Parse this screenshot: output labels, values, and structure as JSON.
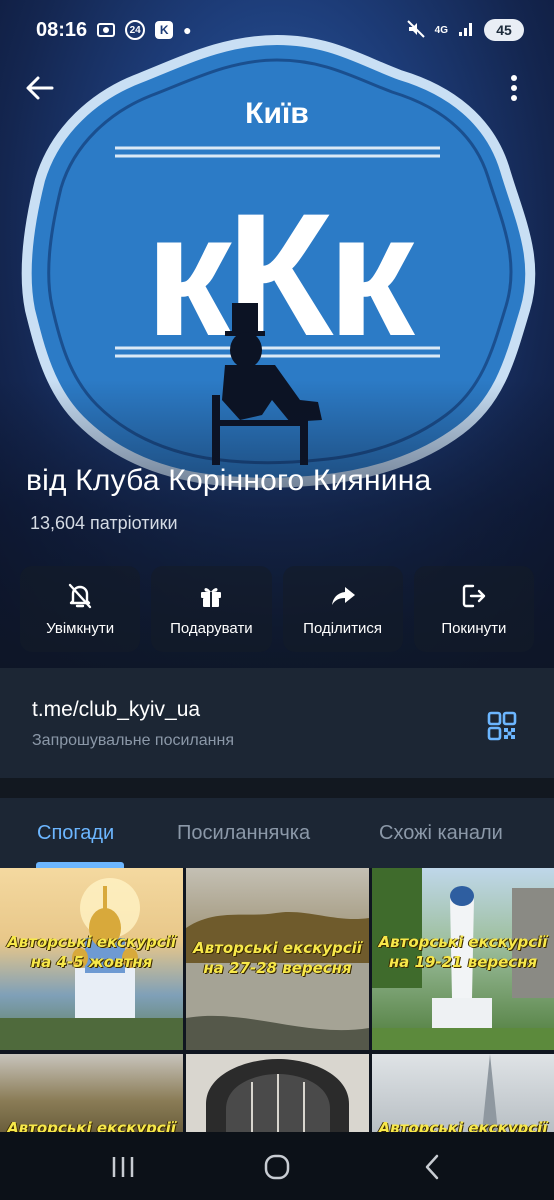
{
  "status_bar": {
    "time": "08:16",
    "notif_badge": "24",
    "battery": "45",
    "network": "4G"
  },
  "header": {
    "emblem_city": "Київ",
    "emblem_letters": "кКк",
    "channel_title": "від Клуба Корінного Киянина",
    "subscriber_count": "13,604 патріотики"
  },
  "actions": [
    {
      "label": "Увімкнути",
      "icon": "bell-off-icon"
    },
    {
      "label": "Подарувати",
      "icon": "gift-icon"
    },
    {
      "label": "Поділитися",
      "icon": "share-icon"
    },
    {
      "label": "Покинути",
      "icon": "leave-icon"
    }
  ],
  "invite": {
    "link": "t.me/club_kyiv_ua",
    "caption": "Запрошувальне посилання"
  },
  "tabs": [
    {
      "label": "Спогади",
      "active": true
    },
    {
      "label": "Посиланнячка",
      "active": false
    },
    {
      "label": "Схожі канали",
      "active": false
    }
  ],
  "media": [
    {
      "caption": "Авторські екскурсії на 4-5 жовтня"
    },
    {
      "caption": "Авторські екскурсії на 27-28 вересня"
    },
    {
      "caption": "Авторські екскурсії на 19-21 вересня"
    },
    {
      "caption": "Авторські екскурсії"
    },
    {
      "caption": ""
    },
    {
      "caption": "Авторські екскурсії"
    }
  ],
  "colors": {
    "accent": "#6cb6ff",
    "caption_yellow": "#f7e84a",
    "surface": "#1c2634"
  }
}
